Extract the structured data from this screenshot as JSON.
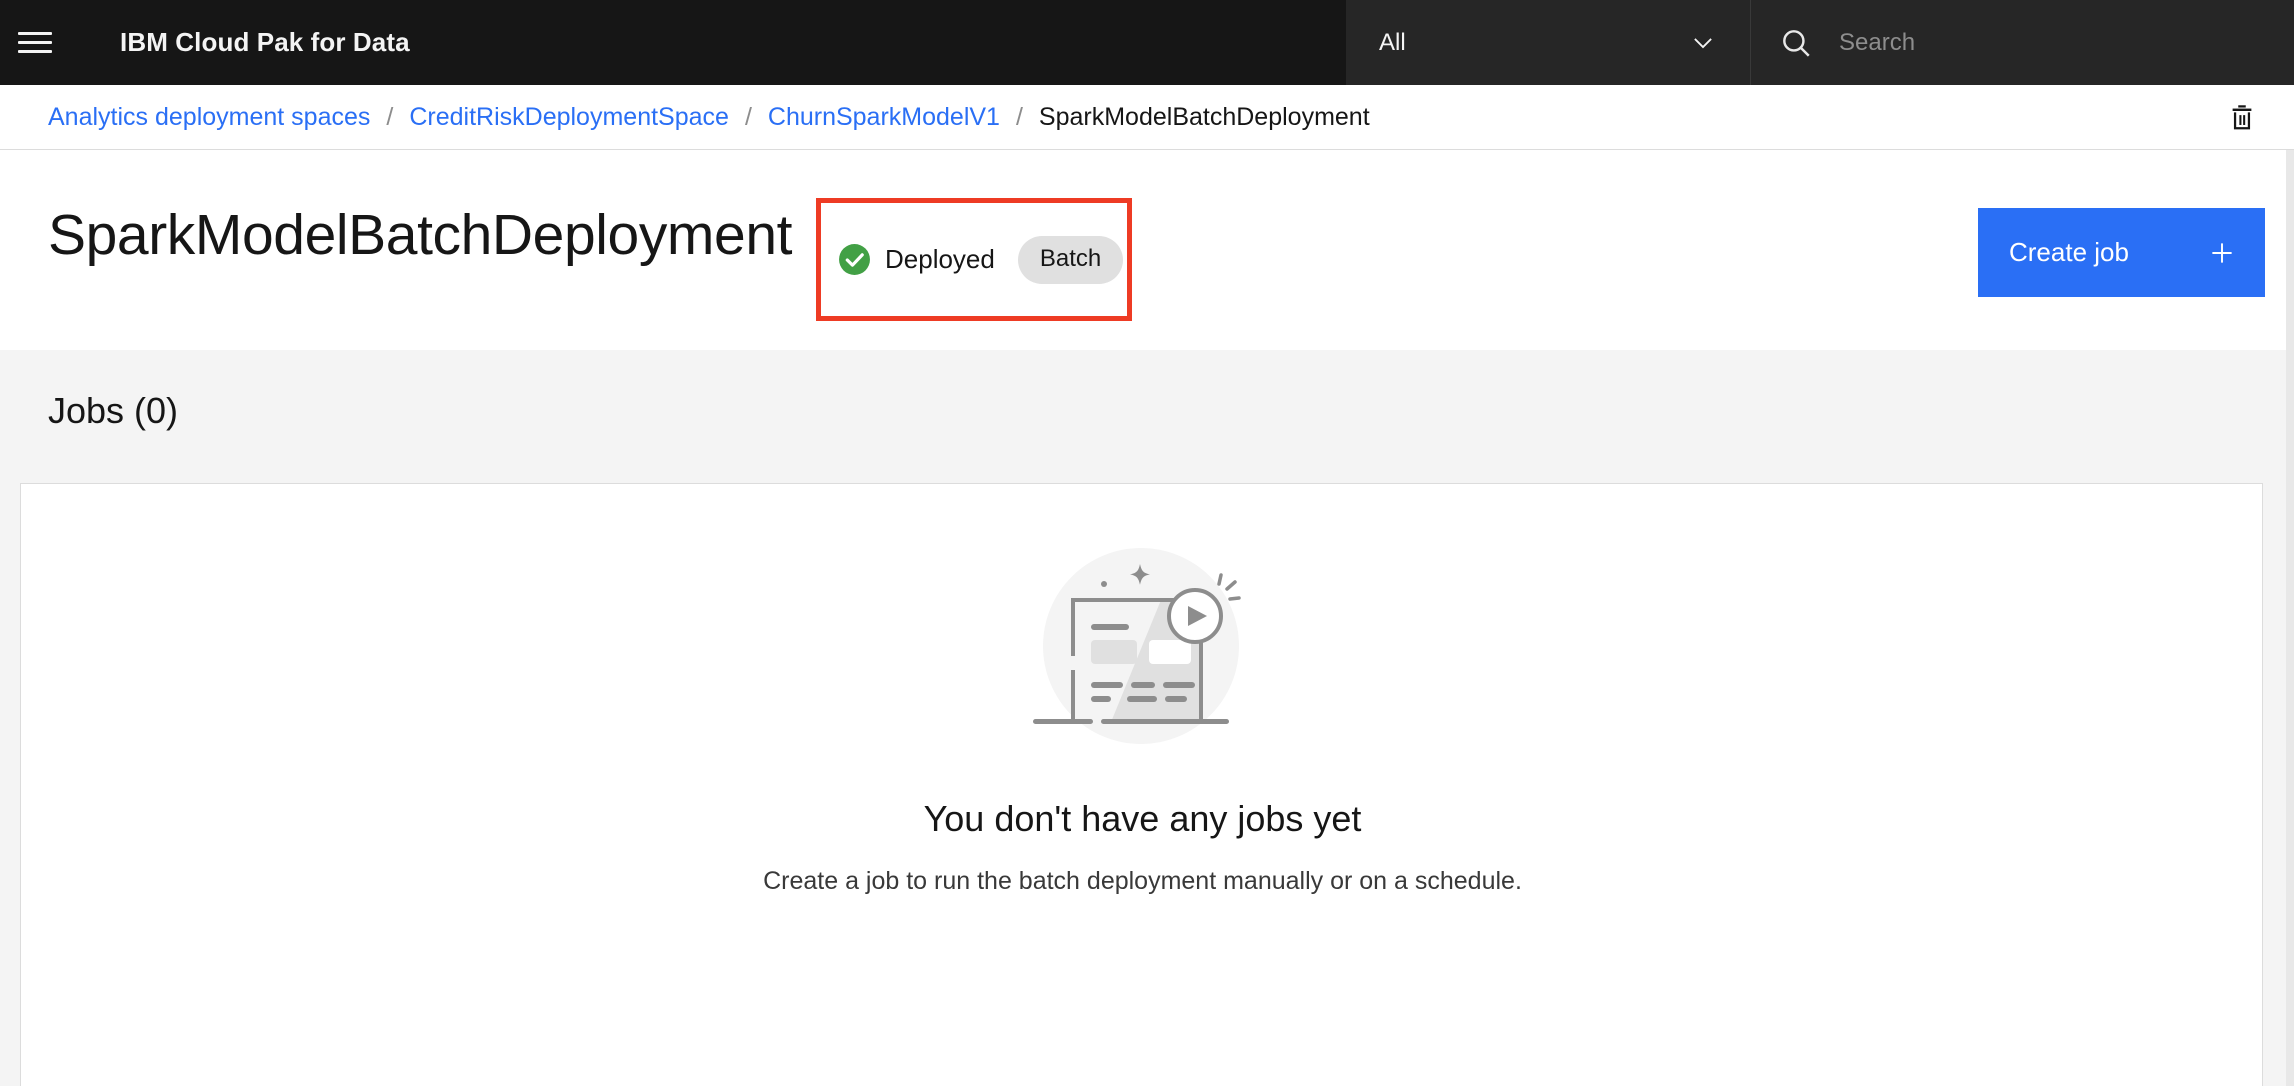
{
  "header": {
    "menu_icon": "hamburger-menu-icon",
    "brand_title": "IBM Cloud Pak for Data",
    "scope_label": "All",
    "scope_chevron": "chevron-down-icon",
    "search_icon": "search-icon",
    "search_value": "",
    "search_placeholder": "Search"
  },
  "breadcrumb": {
    "items": [
      {
        "label": "Analytics deployment spaces",
        "current": false
      },
      {
        "label": "CreditRiskDeploymentSpace",
        "current": false
      },
      {
        "label": "ChurnSparkModelV1",
        "current": false
      },
      {
        "label": "SparkModelBatchDeployment",
        "current": true
      }
    ],
    "separator": "/",
    "delete_icon": "trash-icon"
  },
  "page": {
    "title": "SparkModelBatchDeployment",
    "status_icon": "checkmark-filled-icon",
    "status_label": "Deployed",
    "type_tag": "Batch",
    "create_job_label": "Create job",
    "create_job_icon": "plus-icon",
    "highlight_color": "#ee3b24",
    "accent_color": "#2a6ff5",
    "status_color": "#42a045"
  },
  "jobs": {
    "section_heading": "Jobs (0)",
    "count": 0,
    "empty_illustration": "no-jobs-illustration",
    "empty_title": "You don't have any jobs yet",
    "empty_subtitle": "Create a job to run the batch deployment manually or on a schedule."
  }
}
